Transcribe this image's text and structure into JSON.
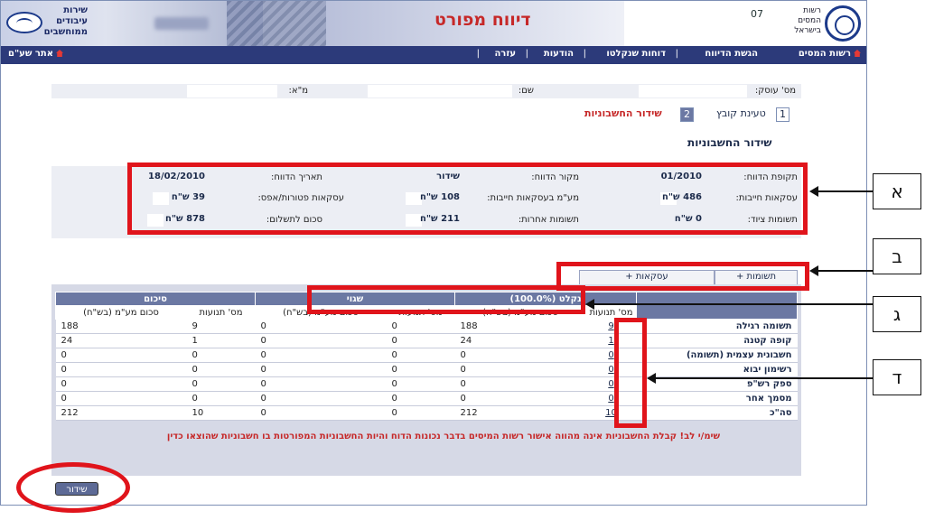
{
  "header": {
    "page_title": "דיווח מפורט",
    "code": "07",
    "authority_name": [
      "רשות",
      "המסים",
      "בישראל"
    ],
    "service_name": [
      "שירות",
      "עיבודים",
      "ממוחשבים"
    ]
  },
  "nav": {
    "home_label": "רשות המסים",
    "items": [
      "הגשת הדיווח",
      "דוחות שנקלטו",
      "הודעות",
      "עזרה"
    ],
    "separator": "|",
    "site_link": "אתר שע\"ם"
  },
  "taxpayer": {
    "dealer_label": "מס' עוסק:",
    "name_label": "שם:",
    "vat_label": "מ\"א:"
  },
  "steps": [
    {
      "num": "1",
      "label": "טעינת קובץ"
    },
    {
      "num": "2",
      "label": "שידור החשבוניות"
    }
  ],
  "section_title": "שידור החשבוניות",
  "summary": {
    "period_label": "תקופת הדווח:",
    "period_value": "01/2010",
    "source_label": "מקור הדווח:",
    "source_value": "שידור",
    "date_label": "תאריך הדווח:",
    "date_value": "18/02/2010",
    "taxable_label": "עסקאות חייבות:",
    "taxable_value": "486 ש\"ח",
    "vat_taxable_label": "מע\"מ בעסקאות חייבות:",
    "vat_taxable_value": "108 ש\"ח",
    "exempt_label": "עסקאות פטורות/אפס:",
    "exempt_value": "39 ש\"ח",
    "equip_label": "תשומות ציוד:",
    "equip_value": "0 ש\"ח",
    "other_label": "תשומות אחרות:",
    "other_value": "211 ש\"ח",
    "pay_label": "סכום לתשלום:",
    "pay_value": "878 ש\"ח"
  },
  "tabs": {
    "inputs": "תשומות +",
    "deals": "עסקאות +"
  },
  "table": {
    "groups": [
      "נקלט (100.0%)",
      "שגוי",
      "סיכום"
    ],
    "subheaders": [
      "מס' תנועות",
      "סכום מע\"מ (בש\"ח)",
      "מס' תנועות",
      "סכום מע\"מ (בש\"ח)",
      "מס' תנועות",
      "סכום מע\"מ (בש\"ח)"
    ],
    "rows": [
      {
        "label": "תשומה רגילה",
        "c1": "9",
        "v1": "188",
        "c2": "0",
        "v2": "0",
        "c3": "9",
        "v3": "188"
      },
      {
        "label": "קופה קטנה",
        "c1": "1",
        "v1": "24",
        "c2": "0",
        "v2": "0",
        "c3": "1",
        "v3": "24"
      },
      {
        "label": "חשבונית עצמית (תשומה)",
        "c1": "0",
        "v1": "0",
        "c2": "0",
        "v2": "0",
        "c3": "0",
        "v3": "0"
      },
      {
        "label": "רשימון יבוא",
        "c1": "0",
        "v1": "0",
        "c2": "0",
        "v2": "0",
        "c3": "0",
        "v3": "0"
      },
      {
        "label": "ספק רש\"פ",
        "c1": "0",
        "v1": "0",
        "c2": "0",
        "v2": "0",
        "c3": "0",
        "v3": "0"
      },
      {
        "label": "מסמך אחר",
        "c1": "0",
        "v1": "0",
        "c2": "0",
        "v2": "0",
        "c3": "0",
        "v3": "0"
      },
      {
        "label": "סה\"כ",
        "c1": "10",
        "v1": "212",
        "c2": "0",
        "v2": "0",
        "c3": "10",
        "v3": "212"
      }
    ]
  },
  "warning": "שימ/י לב! קבלת החשבוניות אינה מהווה אישור רשות המיסים בדבר נכונות הדוח והיות החשבוניות המפורטות בו חשבוניות שהוצאו כדין",
  "submit_label": "שידור",
  "callouts": [
    "א",
    "ב",
    "ג",
    "ד"
  ],
  "annotation_color": "#e0141b"
}
